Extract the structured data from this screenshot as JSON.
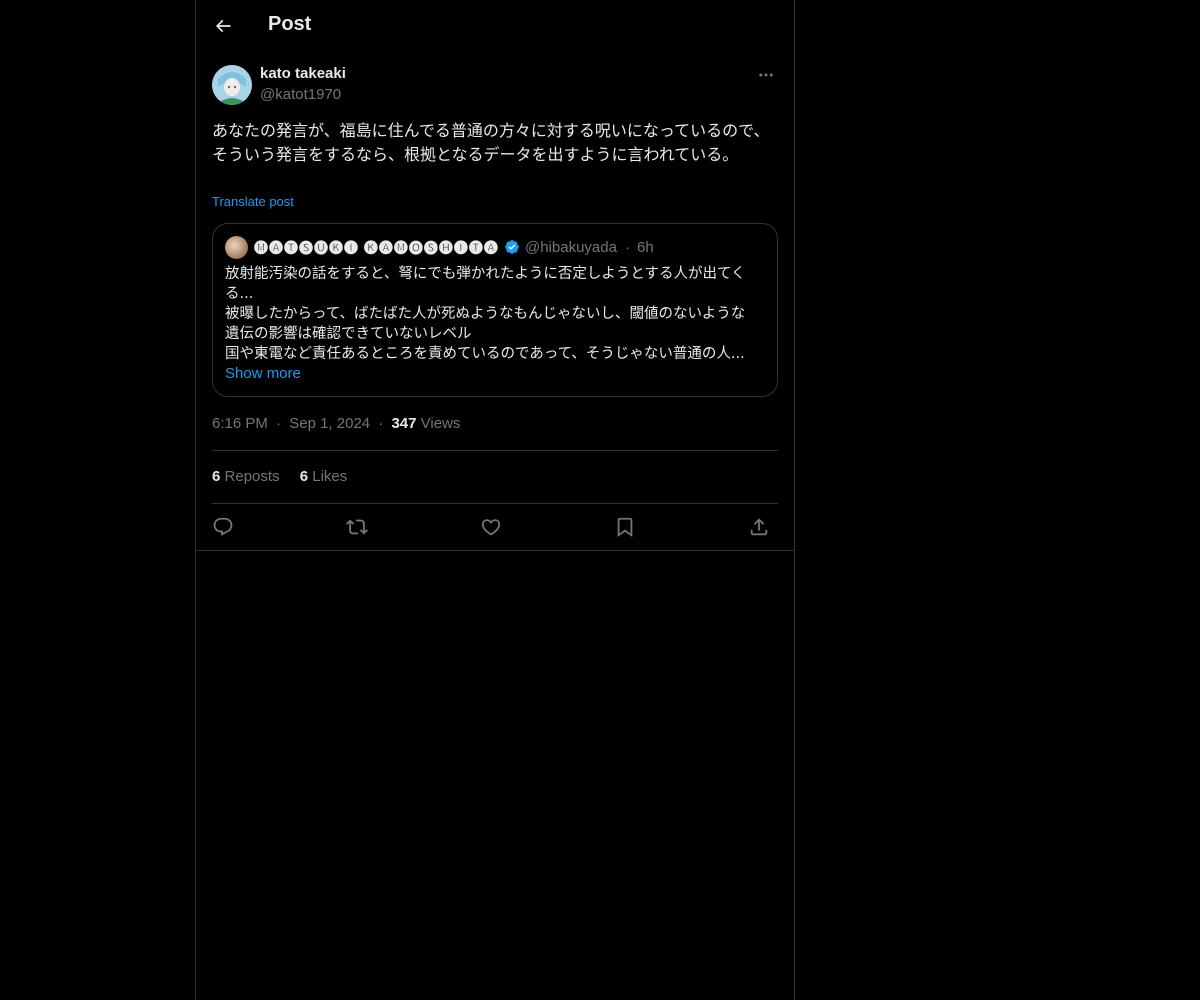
{
  "header": {
    "title": "Post"
  },
  "post": {
    "author_name": "kato takeaki",
    "author_handle": "@katot1970",
    "text": "あなたの発言が、福島に住んでる普通の方々に対する呪いになっているので、そういう発言をするなら、根拠となるデータを出すように言われている。",
    "translate_label": "Translate post",
    "time": "6:16 PM",
    "date": "Sep 1, 2024",
    "views_count": "347",
    "views_label": "Views",
    "reposts_count": "6",
    "reposts_label": "Reposts",
    "likes_count": "6",
    "likes_label": "Likes"
  },
  "quote": {
    "name": "🅜🅐🅣🅢🅤🅚🅘 🅚🅐🅜🅞🅢🅗🅘🅣🅐",
    "handle": "@hibakuyada",
    "separator": "·",
    "time": "6h",
    "lines": [
      "放射能汚染の話をすると、弩にでも弾かれたように否定しようとする人が出てく",
      "る...",
      "被曝したからって、ばたばた人が死ぬようなもんじゃないし、閾値のないような",
      "遺伝の影響は確認できていないレベル",
      "国や東電など責任あるところを責めているのであって、そうじゃない普通の人..."
    ],
    "show_more": "Show more"
  },
  "meta_separator": "·",
  "icons": {
    "back": "back-arrow-icon",
    "more": "more-icon",
    "verified": "verified-badge-icon",
    "reply": "reply-icon",
    "repost": "repost-icon",
    "like": "like-icon",
    "bookmark": "bookmark-icon",
    "share": "share-icon"
  },
  "colors": {
    "background": "#000000",
    "text": "#e7e9ea",
    "secondary": "#71767b",
    "accent": "#1d9bf0",
    "border": "#2f3336"
  }
}
